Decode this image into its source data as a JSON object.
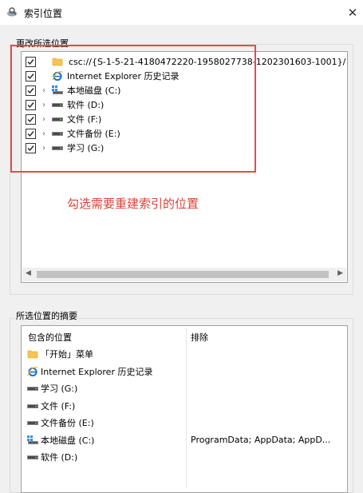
{
  "window": {
    "title": "索引位置",
    "close_glyph": "✕"
  },
  "change_section": {
    "label": "更改所选位置",
    "items": [
      {
        "label": "csc://{S-1-5-21-4180472220-1958027738-1202301603-1001}/",
        "checked": true,
        "expandable": false,
        "icon": "folder-icon"
      },
      {
        "label": "Internet Explorer 历史记录",
        "checked": true,
        "expandable": false,
        "icon": "internet-explorer-icon"
      },
      {
        "label": "本地磁盘 (C:)",
        "checked": true,
        "expandable": true,
        "icon": "system-drive-icon"
      },
      {
        "label": "软件 (D:)",
        "checked": true,
        "expandable": true,
        "icon": "drive-icon"
      },
      {
        "label": "文件 (F:)",
        "checked": true,
        "expandable": true,
        "icon": "drive-icon"
      },
      {
        "label": "文件备份 (E:)",
        "checked": true,
        "expandable": true,
        "icon": "drive-icon"
      },
      {
        "label": "学习 (G:)",
        "checked": true,
        "expandable": true,
        "icon": "drive-icon"
      }
    ],
    "scroll_left": "◀",
    "scroll_right": "▶",
    "expand_glyph": "›"
  },
  "annotation": {
    "text": "勾选需要重建索引的位置",
    "color": "#d9433a"
  },
  "summary_section": {
    "label": "所选位置的摘要",
    "col_included": "包含的位置",
    "col_excluded": "排除",
    "rows": [
      {
        "label": "「开始」菜单",
        "icon": "folder-icon",
        "excluded": ""
      },
      {
        "label": "Internet Explorer 历史记录",
        "icon": "internet-explorer-icon",
        "excluded": ""
      },
      {
        "label": "学习 (G:)",
        "icon": "drive-icon",
        "excluded": ""
      },
      {
        "label": "文件 (F:)",
        "icon": "drive-icon",
        "excluded": ""
      },
      {
        "label": "文件备份 (E:)",
        "icon": "drive-icon",
        "excluded": ""
      },
      {
        "label": "本地磁盘 (C:)",
        "icon": "system-drive-icon",
        "excluded": "ProgramData; AppData; AppD..."
      },
      {
        "label": "软件 (D:)",
        "icon": "drive-icon",
        "excluded": ""
      }
    ]
  },
  "colors": {
    "accent_red": "#e34c4c",
    "folder_yellow": "#f5c451",
    "ie_blue": "#1e73c8"
  }
}
